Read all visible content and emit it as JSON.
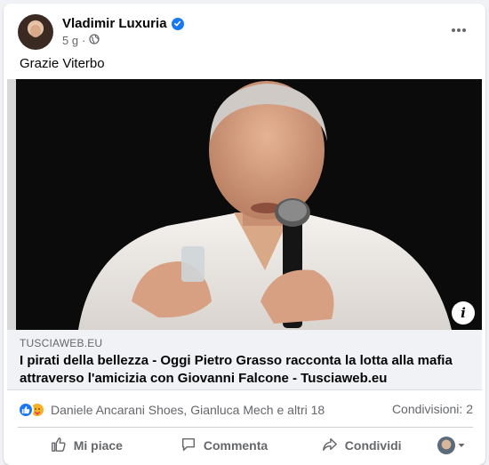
{
  "post": {
    "author": "Vladimir Luxuria",
    "time": "5 g",
    "caption": "Grazie Viterbo"
  },
  "link": {
    "domain": "TUSCIAWEB.EU",
    "title": "I pirati della bellezza - Oggi Pietro Grasso racconta la lotta alla mafia attraverso l'amicizia con Giovanni Falcone - Tusciaweb.eu"
  },
  "engagement": {
    "reactions_names": "Daniele Ancarani Shoes, Gianluca Mech e altri 18",
    "shares": "Condivisioni: 2"
  },
  "actions": {
    "like": "Mi piace",
    "comment": "Commenta",
    "share": "Condividi"
  },
  "colors": {
    "accent": "#1877f2",
    "secondary_text": "#65676b"
  },
  "icons": [
    "verified-badge-icon",
    "globe-icon",
    "more-icon",
    "info-icon",
    "like-reaction-icon",
    "care-reaction-icon",
    "thumbs-up-icon",
    "comment-icon",
    "share-icon",
    "chevron-down-icon"
  ]
}
